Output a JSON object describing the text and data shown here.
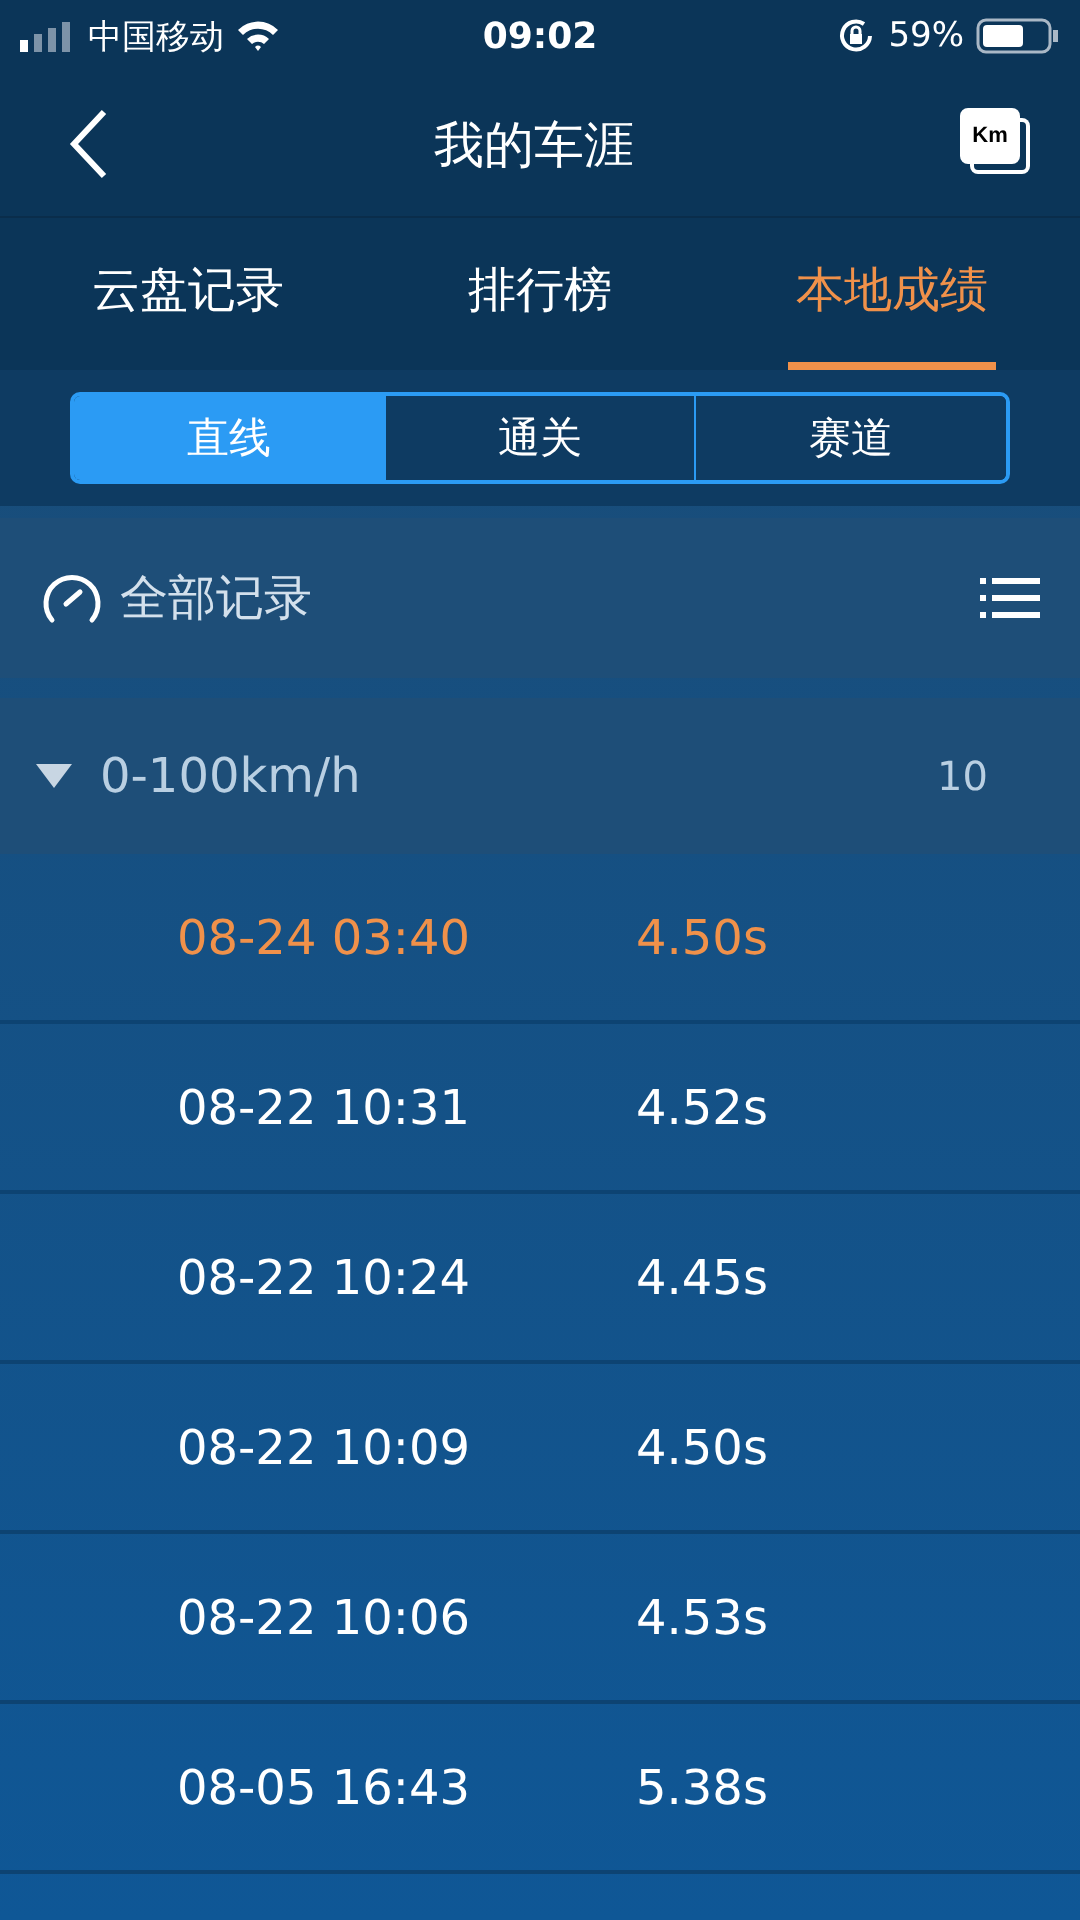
{
  "status_bar": {
    "carrier": "中国移动",
    "time": "09:02",
    "battery": "59%"
  },
  "nav": {
    "title": "我的车涯",
    "unit_button": "Km"
  },
  "tabs": [
    {
      "label": "云盘记录",
      "selected": false
    },
    {
      "label": "排行榜",
      "selected": false
    },
    {
      "label": "本地成绩",
      "selected": true
    }
  ],
  "segments": [
    {
      "label": "直线",
      "selected": true
    },
    {
      "label": "通关",
      "selected": false
    },
    {
      "label": "赛道",
      "selected": false
    }
  ],
  "filter": {
    "label": "全部记录"
  },
  "group": {
    "title": "0-100km/h",
    "count": "10",
    "expanded": true
  },
  "records": [
    {
      "time": "08-24 03:40",
      "result": "4.50s",
      "selected": true
    },
    {
      "time": "08-22 10:31",
      "result": "4.52s",
      "selected": false
    },
    {
      "time": "08-22 10:24",
      "result": "4.45s",
      "selected": false
    },
    {
      "time": "08-22 10:09",
      "result": "4.50s",
      "selected": false
    },
    {
      "time": "08-22 10:06",
      "result": "4.53s",
      "selected": false
    },
    {
      "time": "08-05 16:43",
      "result": "5.38s",
      "selected": false
    }
  ]
}
